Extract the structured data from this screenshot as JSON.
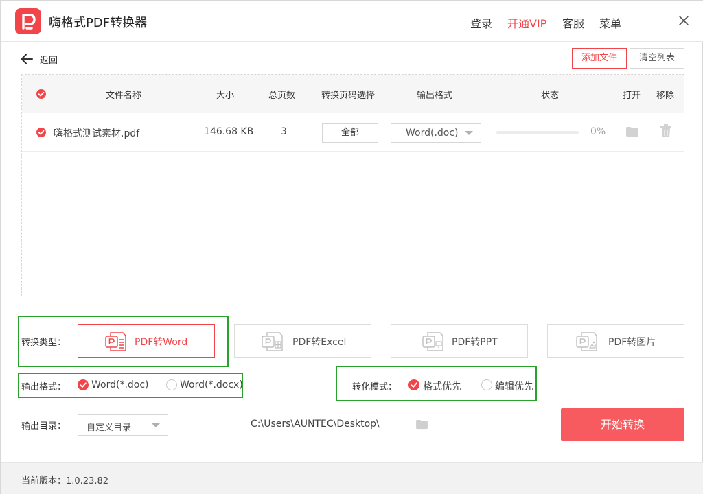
{
  "titlebar": {
    "app_title": "嗨格式PDF转换器",
    "links": {
      "login": "登录",
      "vip": "开通VIP",
      "service": "客服",
      "menu": "菜单"
    }
  },
  "toolbar": {
    "back_label": "返回",
    "add_file_label": "添加文件",
    "clear_list_label": "清空列表"
  },
  "table": {
    "headers": {
      "name": "文件名称",
      "size": "大小",
      "pages": "总页数",
      "page_range": "转换页码选择",
      "output_format": "输出格式",
      "status": "状态",
      "open": "打开",
      "remove": "移除"
    },
    "rows": [
      {
        "name": "嗨格式测试素材.pdf",
        "size": "146.68 KB",
        "pages": "3",
        "page_range": "全部",
        "output_format": "Word(.doc)",
        "progress_percent": 0,
        "progress_text": "0%"
      }
    ]
  },
  "conversion": {
    "type_label": "转换类型：",
    "tabs": [
      {
        "label": "PDF转Word",
        "active": true
      },
      {
        "label": "PDF转Excel",
        "active": false
      },
      {
        "label": "PDF转PPT",
        "active": false
      },
      {
        "label": "PDF转图片",
        "active": false
      }
    ]
  },
  "output_format": {
    "label": "输出格式：",
    "options": [
      {
        "label": "Word(*.doc)",
        "selected": true
      },
      {
        "label": "Word(*.docx)",
        "selected": false
      }
    ]
  },
  "conversion_mode": {
    "label": "转化模式：",
    "options": [
      {
        "label": "格式优先",
        "selected": true
      },
      {
        "label": "编辑优先",
        "selected": false
      }
    ]
  },
  "output_dir": {
    "label": "输出目录：",
    "select_value": "自定义目录",
    "path": "C:\\Users\\AUNTEC\\Desktop\\"
  },
  "start_button_label": "开始转换",
  "footer": {
    "version": "当前版本：1.0.23.82"
  },
  "colors": {
    "accent": "#f2454a",
    "start_button": "#f75b5f",
    "highlight_box": "#29a32d"
  }
}
